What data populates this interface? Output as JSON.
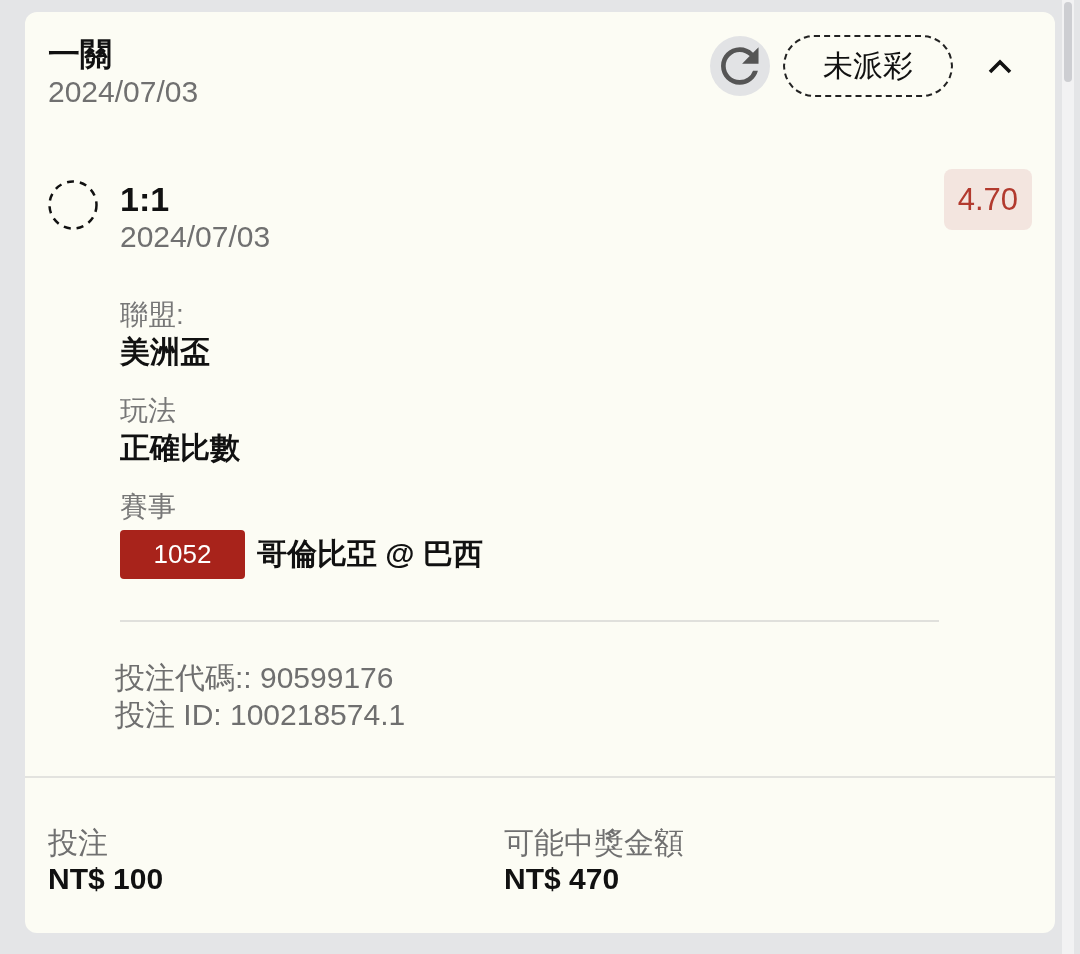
{
  "ticket": {
    "title": "一關",
    "date": "2024/07/03",
    "status": "未派彩",
    "expanded": true
  },
  "selections": [
    {
      "settled": false,
      "pick": "1:1",
      "date": "2024/07/03",
      "odds": "4.70",
      "details": [
        {
          "label": "聯盟:",
          "value": "美洲盃"
        },
        {
          "label": "玩法",
          "value": "正確比數"
        }
      ],
      "event": {
        "label": "賽事",
        "code": "1052",
        "name": "哥倫比亞 @ 巴西"
      }
    }
  ],
  "bet_info": [
    "投注代碼:: 90599176",
    "投注 ID: 100218574.1"
  ],
  "summary": [
    {
      "label": "投注",
      "value": "NT$ 100"
    },
    {
      "label": "可能中獎金額",
      "value": "NT$ 470"
    }
  ]
}
